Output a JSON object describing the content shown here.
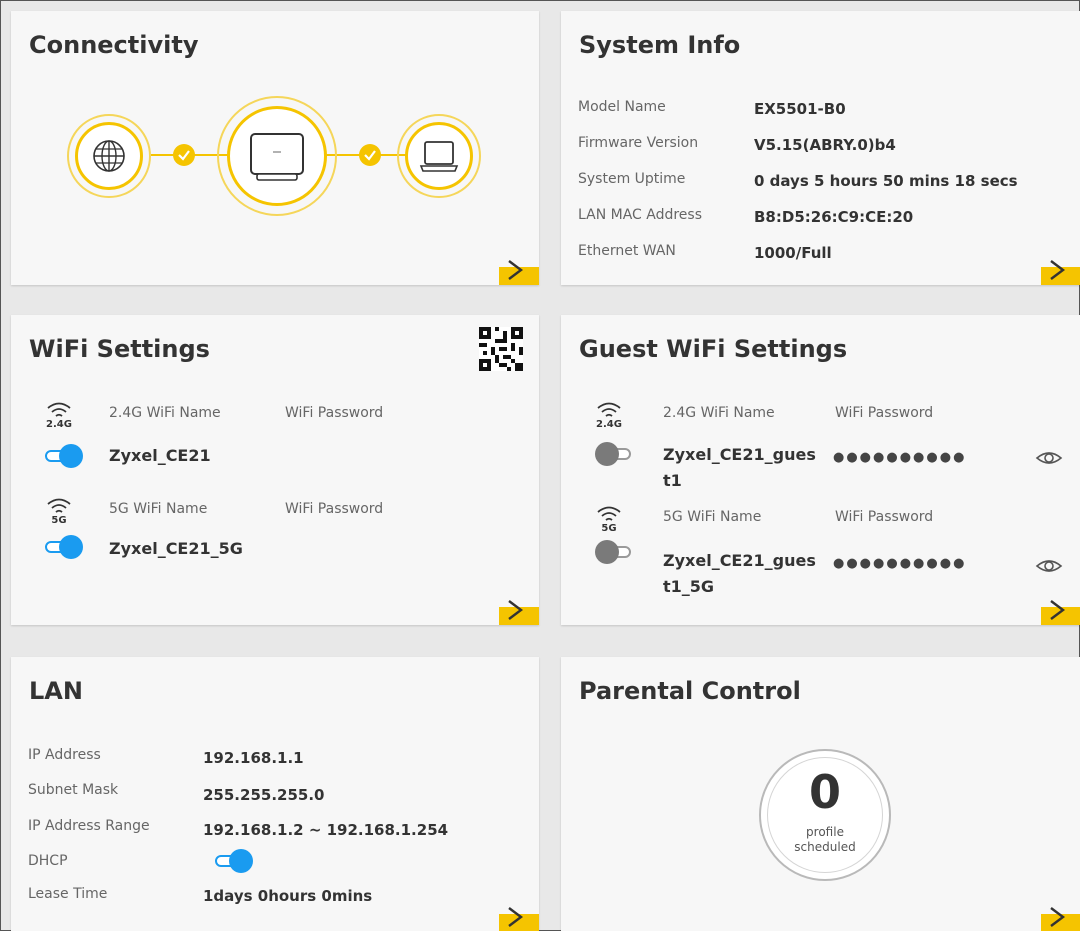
{
  "connectivity": {
    "title": "Connectivity"
  },
  "system_info": {
    "title": "System Info",
    "rows": [
      {
        "label": "Model Name",
        "value": "EX5501-B0"
      },
      {
        "label": "Firmware Version",
        "value": "V5.15(ABRY.0)b4"
      },
      {
        "label": "System Uptime",
        "value": "0 days 5 hours 50 mins 18 secs"
      },
      {
        "label": "LAN MAC Address",
        "value": "B8:D5:26:C9:CE:20"
      },
      {
        "label": "Ethernet WAN",
        "value": "1000/Full"
      }
    ]
  },
  "wifi": {
    "title": "WiFi Settings",
    "bands": [
      {
        "band": "2.4G",
        "name_label": "2.4G WiFi Name",
        "password_label": "WiFi Password",
        "ssid": "Zyxel_CE21",
        "enabled": true
      },
      {
        "band": "5G",
        "name_label": "5G WiFi Name",
        "password_label": "WiFi Password",
        "ssid": "Zyxel_CE21_5G",
        "enabled": true
      }
    ]
  },
  "guest_wifi": {
    "title": "Guest WiFi Settings",
    "bands": [
      {
        "band": "2.4G",
        "name_label": "2.4G WiFi Name",
        "password_label": "WiFi Password",
        "ssid_line1": "Zyxel_CE21_gues",
        "ssid_line2": "t1",
        "password_mask": "●●●●●●●●●●",
        "enabled": false
      },
      {
        "band": "5G",
        "name_label": "5G WiFi Name",
        "password_label": "WiFi Password",
        "ssid_line1": "Zyxel_CE21_gues",
        "ssid_line2": "t1_5G",
        "password_mask": "●●●●●●●●●●",
        "enabled": false
      }
    ]
  },
  "lan": {
    "title": "LAN",
    "rows": [
      {
        "label": "IP Address",
        "value": "192.168.1.1"
      },
      {
        "label": "Subnet Mask",
        "value": "255.255.255.0"
      },
      {
        "label": "IP Address Range",
        "value": "192.168.1.2 ~ 192.168.1.254"
      },
      {
        "label": "DHCP",
        "value": ""
      },
      {
        "label": "Lease Time",
        "value": "1days 0hours 0mins"
      }
    ],
    "dhcp_enabled": true
  },
  "parental_control": {
    "title": "Parental Control",
    "count": "0",
    "label_line1": "profile",
    "label_line2": "scheduled"
  },
  "colors": {
    "accent_yellow": "#f5c400",
    "toggle_blue": "#1a9bf0",
    "toggle_off": "#7a7a7a"
  },
  "icons": {
    "globe": "globe-icon",
    "router": "router-icon",
    "laptop": "laptop-icon",
    "check": "check-icon",
    "wifi": "wifi-icon",
    "eye": "eye-icon",
    "qr": "qr-code-icon",
    "arrow": "chevron-right-icon"
  }
}
